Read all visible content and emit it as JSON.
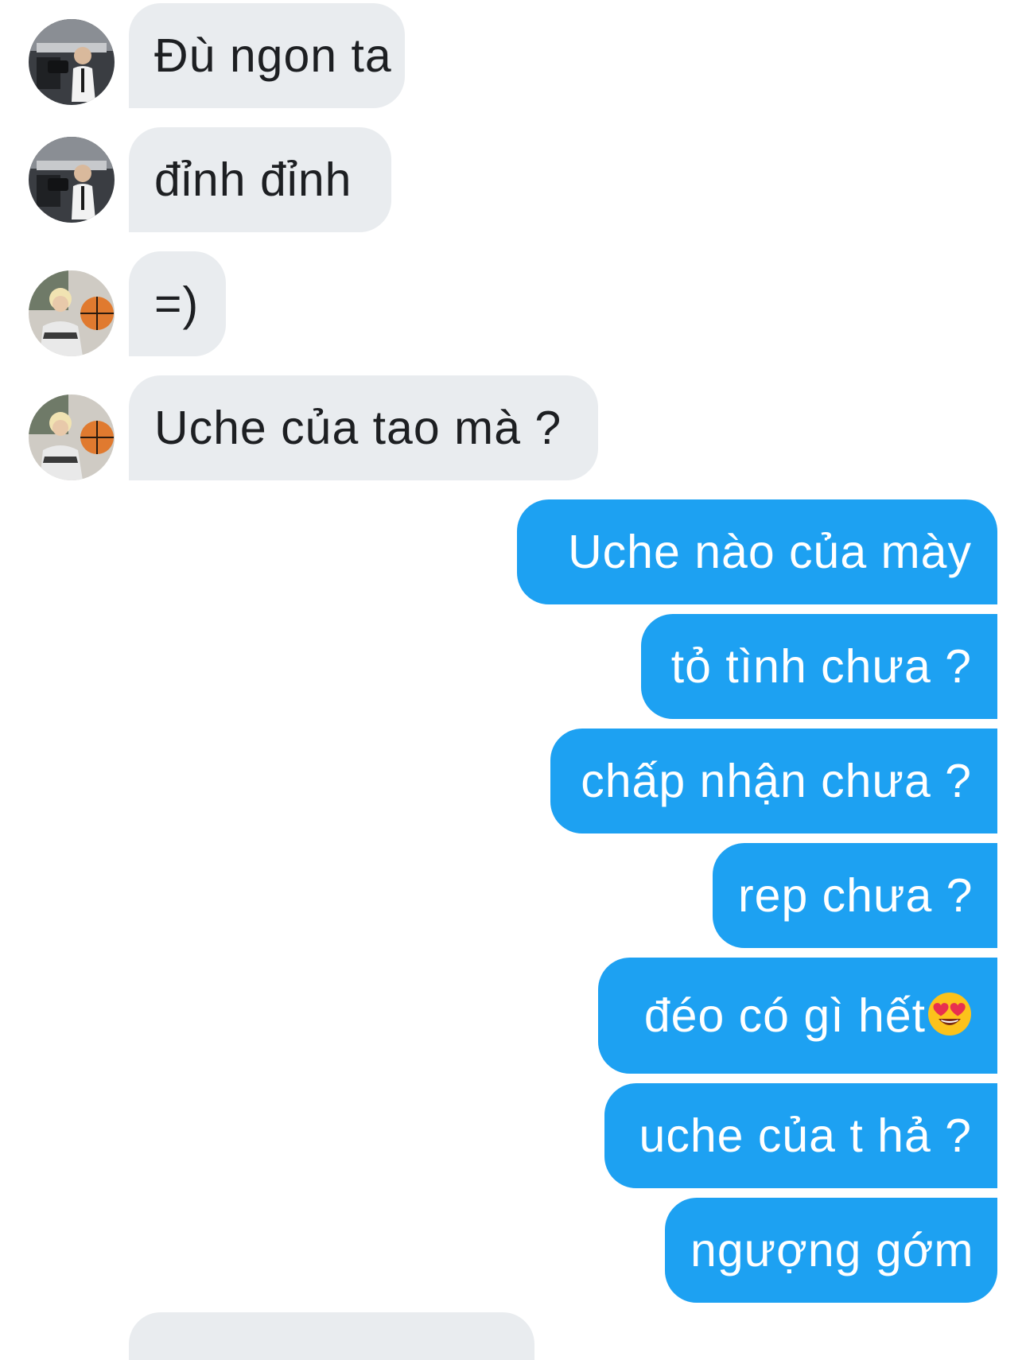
{
  "chat": {
    "colors": {
      "incoming_bg": "#e9ecef",
      "incoming_text": "#1d1f22",
      "outgoing_bg": "#1da1f2",
      "outgoing_text": "#ffffff"
    },
    "messages": [
      {
        "direction": "in",
        "sender_avatar": "avatar-person-camera",
        "text": "Đù ngon ta"
      },
      {
        "direction": "in",
        "sender_avatar": "avatar-person-camera",
        "text": "đỉnh đỉnh"
      },
      {
        "direction": "in",
        "sender_avatar": "avatar-person-basketball",
        "text": "=)"
      },
      {
        "direction": "in",
        "sender_avatar": "avatar-person-basketball",
        "text": "Uche của tao mà ?"
      },
      {
        "direction": "out",
        "text": "Uche nào của mày"
      },
      {
        "direction": "out",
        "text": "tỏ tình chưa ?"
      },
      {
        "direction": "out",
        "text": "chấp nhận chưa ?"
      },
      {
        "direction": "out",
        "text": "rep chưa ?"
      },
      {
        "direction": "out",
        "text": "đéo có gì hết",
        "emoji": "heart-eyes-emoji"
      },
      {
        "direction": "out",
        "text": "uche của t hả ?"
      },
      {
        "direction": "out",
        "text": "ngượng gớm"
      }
    ]
  }
}
